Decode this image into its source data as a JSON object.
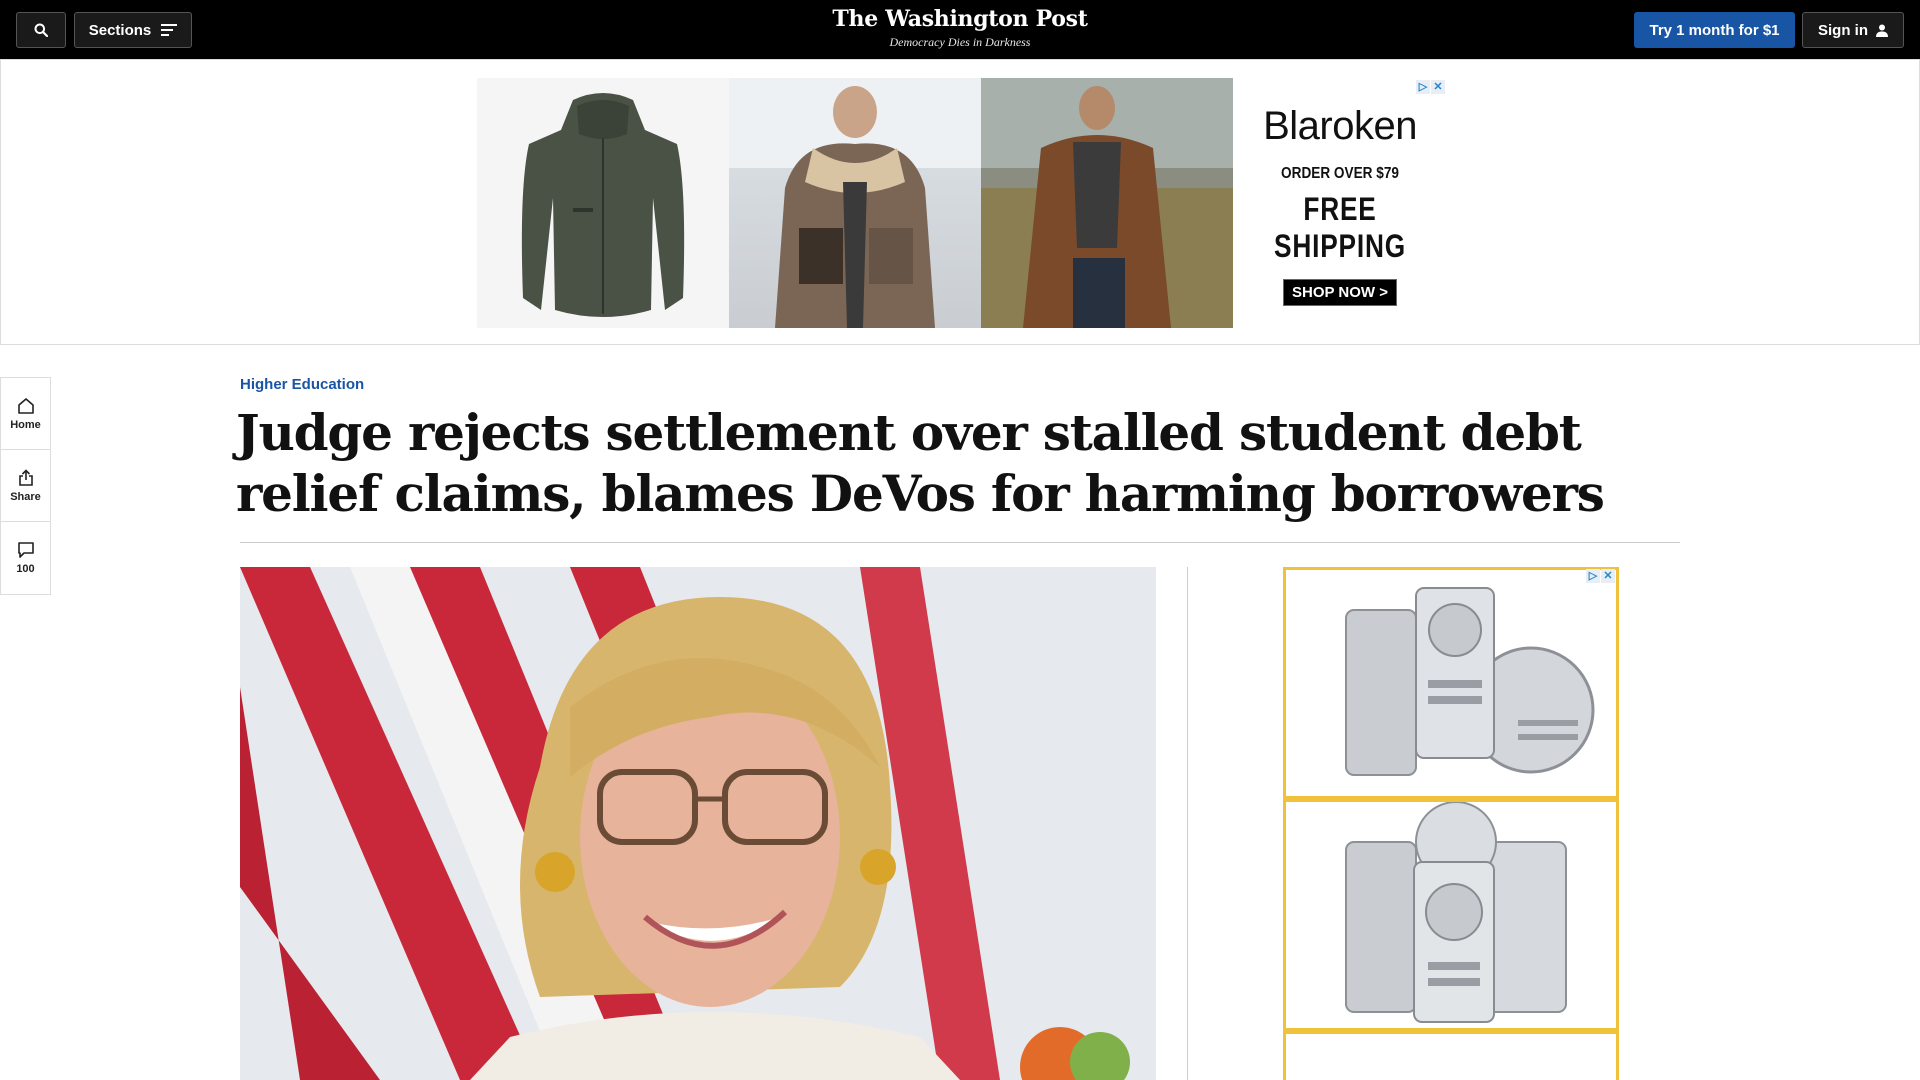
{
  "header": {
    "search_icon": "search-icon",
    "sections_label": "Sections",
    "masthead_title": "The Washington Post",
    "tagline": "Democracy Dies in Darkness",
    "subscribe_label": "Try 1 month for $1",
    "signin_label": "Sign in"
  },
  "top_ad": {
    "brand": "Blaroken",
    "offer": "ORDER OVER $79",
    "headline": "FREE SHIPPING",
    "cta": "SHOP NOW >"
  },
  "left_rail": {
    "home_label": "Home",
    "share_label": "Share",
    "comments_count": "100"
  },
  "article": {
    "kicker": "Higher Education",
    "headline": "Judge rejects settlement over stalled student debt relief claims, blames DeVos for harming borrowers"
  },
  "colors": {
    "topbar": "#000000",
    "subscribe": "#1955a5",
    "kicker": "#1955a5",
    "ad_border": "#f0c23c"
  }
}
